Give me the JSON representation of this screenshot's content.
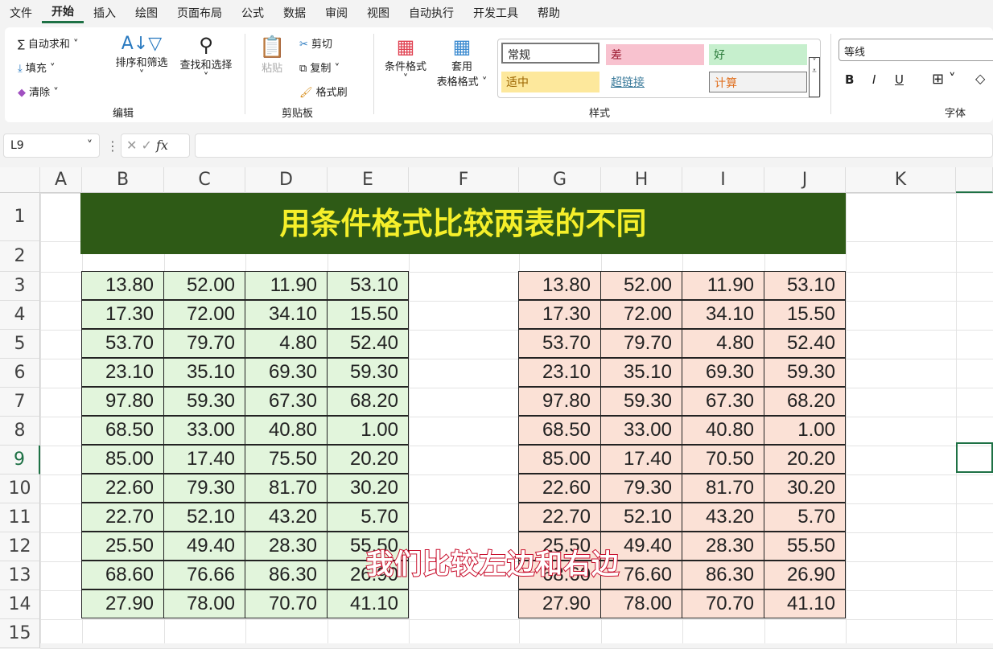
{
  "menu": [
    "文件",
    "开始",
    "插入",
    "绘图",
    "页面布局",
    "公式",
    "数据",
    "审阅",
    "视图",
    "自动执行",
    "开发工具",
    "帮助"
  ],
  "ribbon": {
    "editing": {
      "autosum": "自动求和",
      "fill": "填充",
      "clear": "清除",
      "sort": "排序和筛选",
      "find": "查找和选择",
      "group": "编辑"
    },
    "clipboard": {
      "paste": "粘贴",
      "cut": "剪切",
      "copy": "复制",
      "painter": "格式刷",
      "group": "剪贴板"
    },
    "cond_format": "条件格式",
    "table_format_1": "套用",
    "table_format_2": "表格格式",
    "styles": {
      "normal": "常规",
      "bad": "差",
      "good": "好",
      "neutral": "适中",
      "hyperlink": "超链接",
      "calc": "计算",
      "group": "样式"
    },
    "font": {
      "name": "等线",
      "bold": "B",
      "italic": "I",
      "underline": "U",
      "group": "字体"
    }
  },
  "formula_bar": {
    "name_box": "L9",
    "fx": "fx",
    "value": ""
  },
  "columns": [
    "A",
    "B",
    "C",
    "D",
    "E",
    "F",
    "G",
    "H",
    "I",
    "J",
    "K"
  ],
  "rows": [
    "1",
    "2",
    "3",
    "4",
    "5",
    "6",
    "7",
    "8",
    "9",
    "10",
    "11",
    "12",
    "13",
    "14",
    "15"
  ],
  "title": "用条件格式比较两表的不同",
  "left_table": [
    [
      "13.80",
      "52.00",
      "11.90",
      "53.10"
    ],
    [
      "17.30",
      "72.00",
      "34.10",
      "15.50"
    ],
    [
      "53.70",
      "79.70",
      "4.80",
      "52.40"
    ],
    [
      "23.10",
      "35.10",
      "69.30",
      "59.30"
    ],
    [
      "97.80",
      "59.30",
      "67.30",
      "68.20"
    ],
    [
      "68.50",
      "33.00",
      "40.80",
      "1.00"
    ],
    [
      "85.00",
      "17.40",
      "75.50",
      "20.20"
    ],
    [
      "22.60",
      "79.30",
      "81.70",
      "30.20"
    ],
    [
      "22.70",
      "52.10",
      "43.20",
      "5.70"
    ],
    [
      "25.50",
      "49.40",
      "28.30",
      "55.50"
    ],
    [
      "68.60",
      "76.66",
      "86.30",
      "26.90"
    ],
    [
      "27.90",
      "78.00",
      "70.70",
      "41.10"
    ]
  ],
  "right_table": [
    [
      "13.80",
      "52.00",
      "11.90",
      "53.10"
    ],
    [
      "17.30",
      "72.00",
      "34.10",
      "15.50"
    ],
    [
      "53.70",
      "79.70",
      "4.80",
      "52.40"
    ],
    [
      "23.10",
      "35.10",
      "69.30",
      "59.30"
    ],
    [
      "97.80",
      "59.30",
      "67.30",
      "68.20"
    ],
    [
      "68.50",
      "33.00",
      "40.80",
      "1.00"
    ],
    [
      "85.00",
      "17.40",
      "70.50",
      "20.20"
    ],
    [
      "22.60",
      "79.30",
      "81.70",
      "30.20"
    ],
    [
      "22.70",
      "52.10",
      "43.20",
      "5.70"
    ],
    [
      "25.50",
      "49.40",
      "28.30",
      "55.50"
    ],
    [
      "68.60",
      "76.60",
      "86.30",
      "26.90"
    ],
    [
      "27.90",
      "78.00",
      "70.70",
      "41.10"
    ]
  ],
  "subtitle": "我们比较左边和右边",
  "colors": {
    "left_fill": "#e2f5dc",
    "right_fill": "#fbe1d6",
    "title_bg": "#2e5a16",
    "title_text": "#f5ef2a",
    "accent": "#1e7145"
  }
}
